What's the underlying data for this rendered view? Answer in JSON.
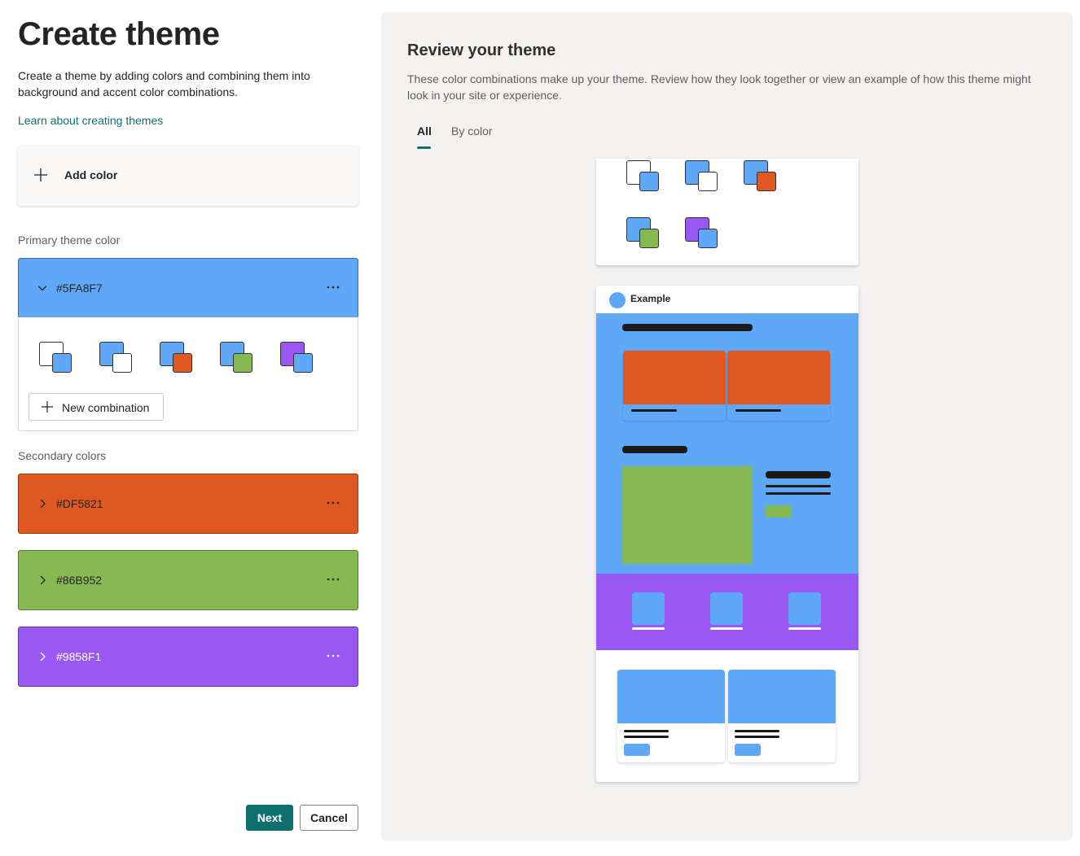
{
  "left": {
    "title": "Create theme",
    "description": "Create a theme by adding colors and combining them into background and accent color combinations.",
    "learn_link": "Learn about creating themes",
    "add_color_label": "Add color",
    "primary_label": "Primary theme color",
    "primary": {
      "hex": "#5FA8F7",
      "color": "#5FA8F7",
      "expanded": true
    },
    "new_combination_label": "New combination",
    "secondary_label": "Secondary colors",
    "secondary": [
      {
        "hex": "#DF5821",
        "color": "#DF5821"
      },
      {
        "hex": "#86B952",
        "color": "#86B952"
      },
      {
        "hex": "#9858F1",
        "color": "#9858F1"
      }
    ],
    "next_label": "Next",
    "cancel_label": "Cancel"
  },
  "right": {
    "title": "Review your theme",
    "description": "These color combinations make up your theme. Review how they look together or view an example of how this theme might look in your site or experience.",
    "tabs": [
      {
        "label": "All",
        "selected": true
      },
      {
        "label": "By color",
        "selected": false
      }
    ],
    "example_title": "Example"
  },
  "combinations": [
    {
      "bg": "#FFFFFF",
      "fg": "#5FA8F7"
    },
    {
      "bg": "#5FA8F7",
      "fg": "#FFFFFF"
    },
    {
      "bg": "#5FA8F7",
      "fg": "#DF5821"
    },
    {
      "bg": "#5FA8F7",
      "fg": "#86B952"
    },
    {
      "bg": "#9858F1",
      "fg": "#5FA8F7"
    }
  ],
  "colors": {
    "accent": "#0F6F6F",
    "primary": "#5FA8F7",
    "orange": "#DF5821",
    "green": "#86B952",
    "purple": "#9858F1"
  }
}
